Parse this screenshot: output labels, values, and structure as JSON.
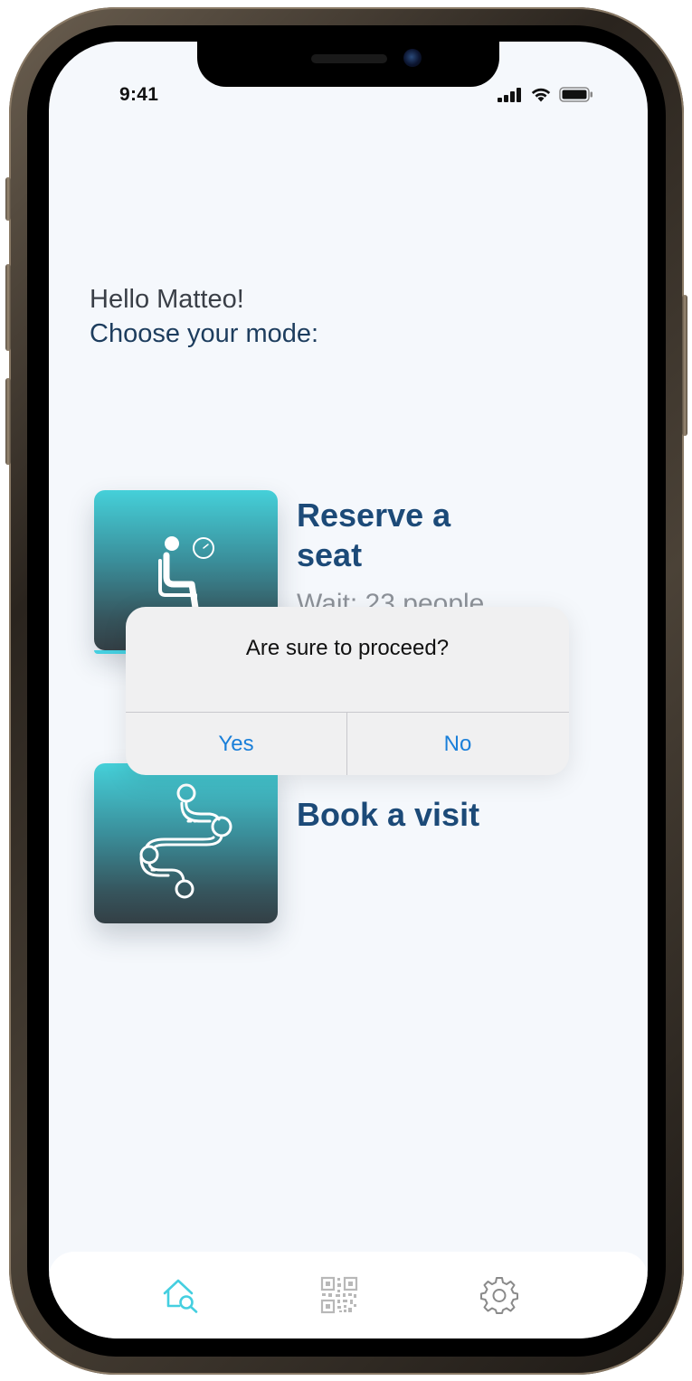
{
  "status_bar": {
    "time": "9:41",
    "icons": [
      "signal-icon",
      "wifi-icon",
      "battery-icon"
    ]
  },
  "greeting": {
    "hello": "Hello Matteo!",
    "prompt": "Choose your mode:"
  },
  "modes": [
    {
      "title": "Reserve a seat",
      "subtitle": "Wait: 23 people",
      "icon": "seated-person-clock-icon"
    },
    {
      "title": "Book a visit",
      "icon": "route-path-icon"
    }
  ],
  "dialog": {
    "message": "Are sure to proceed?",
    "yes_label": "Yes",
    "no_label": "No"
  },
  "tab_bar": {
    "tabs": [
      {
        "icon": "home-search-icon",
        "active": true
      },
      {
        "icon": "qr-code-icon",
        "active": false
      },
      {
        "icon": "gear-icon",
        "active": false
      }
    ]
  },
  "colors": {
    "accent": "#45cfe0",
    "title": "#1c4a78",
    "dialog_button": "#1a7fd9",
    "screen_bg": "#f5f8fc"
  }
}
